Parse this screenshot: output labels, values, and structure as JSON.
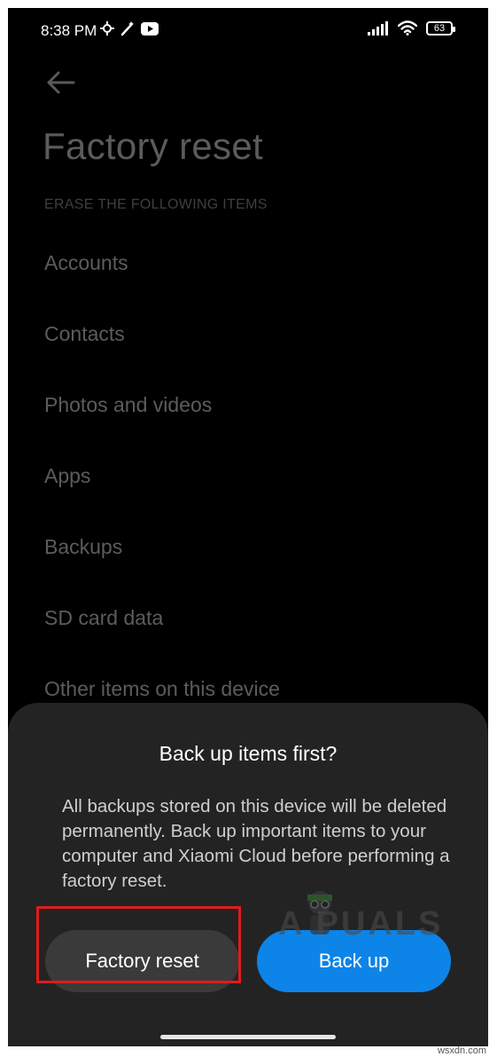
{
  "status_bar": {
    "time": "8:38 PM",
    "battery": "63",
    "icons_left": [
      "sync-icon",
      "wand-icon",
      "youtube-icon"
    ],
    "icons_right": [
      "signal-icon",
      "wifi-icon",
      "battery-icon"
    ]
  },
  "header": {
    "back_icon": "back-arrow-icon",
    "title": "Factory reset"
  },
  "list": {
    "section_label": "ERASE THE FOLLOWING ITEMS",
    "items": [
      "Accounts",
      "Contacts",
      "Photos and videos",
      "Apps",
      "Backups",
      "SD card data",
      "Other items on this device"
    ]
  },
  "dialog": {
    "title": "Back up items first?",
    "message": "All backups stored on this device will be deleted permanently. Back up important items to your computer and Xiaomi Cloud before performing a factory reset.",
    "reset_label": "Factory reset",
    "backup_label": "Back up"
  },
  "watermark": "A  PUALS",
  "credit": "wsxdn.com",
  "colors": {
    "background": "#000000",
    "sheet": "#232323",
    "primary_button": "#0d84e8",
    "secondary_button": "#3a3a3a",
    "highlight": "#e11b1b"
  }
}
